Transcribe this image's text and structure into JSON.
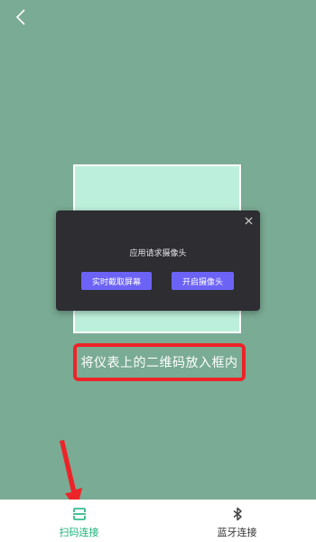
{
  "icons": {
    "back": "chevron-left-icon",
    "close": "close-icon",
    "scan": "scan-icon",
    "bluetooth": "bluetooth-icon"
  },
  "colors": {
    "background": "#7aab94",
    "scan_frame": "#bdf0dc",
    "highlight_border": "#ec2429",
    "dialog_background": "#2d2d32",
    "dialog_button": "#6c63f6",
    "active_tab": "#1ab17a"
  },
  "scanner": {
    "hint": "将仪表上的二维码放入框内"
  },
  "dialog": {
    "title": "应用请求摄像头",
    "left_button": "实时截取屏幕",
    "right_button": "开启摄像头"
  },
  "tabs": [
    {
      "label": "扫码连接",
      "active": true
    },
    {
      "label": "蓝牙连接",
      "active": false
    }
  ]
}
